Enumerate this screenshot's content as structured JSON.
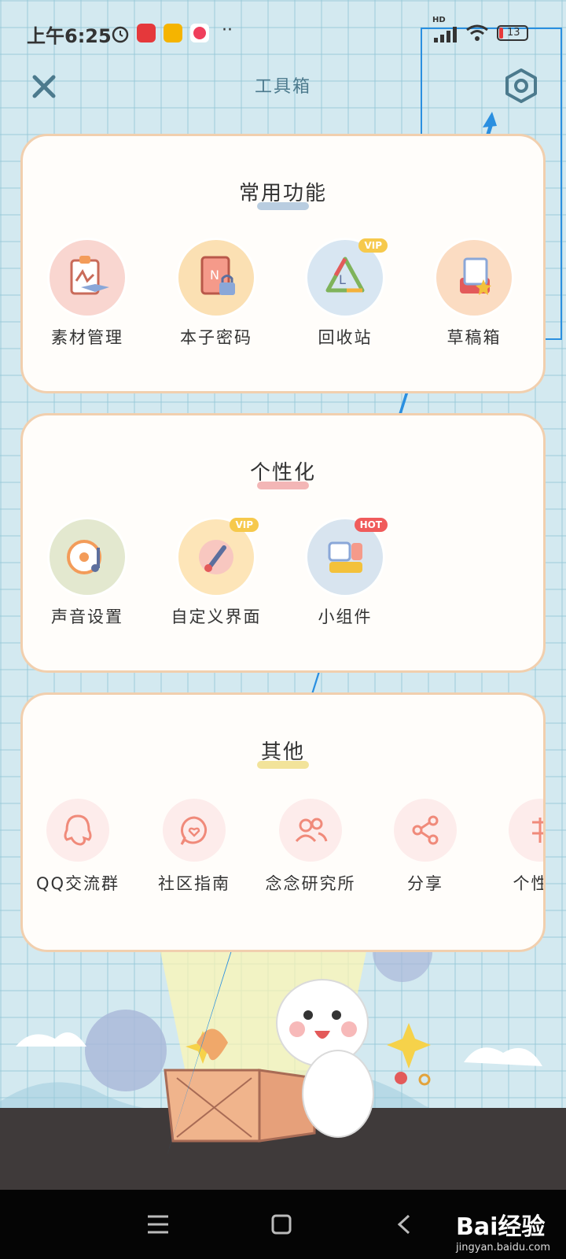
{
  "status_bar": {
    "time": "上午6:25",
    "more": "··",
    "hd": "HD",
    "battery": "13"
  },
  "header": {
    "title": "工具箱"
  },
  "sections": [
    {
      "title": "常用功能",
      "underline_color": "#b9cde0",
      "items": [
        {
          "label": "素材管理",
          "icon": "clipboard-layers-icon",
          "color": "#f9d6d0"
        },
        {
          "label": "本子密码",
          "icon": "notebook-lock-icon",
          "color": "#fbe0b3"
        },
        {
          "label": "回收站",
          "icon": "recycle-icon",
          "color": "#d8e6f2",
          "badge": "VIP"
        },
        {
          "label": "草稿箱",
          "icon": "draft-box-icon",
          "color": "#fbdcc2"
        }
      ]
    },
    {
      "title": "个性化",
      "underline_color": "#f3b6b6",
      "items": [
        {
          "label": "声音设置",
          "icon": "music-disc-icon",
          "color": "#e3e8cf"
        },
        {
          "label": "自定义界面",
          "icon": "paint-brush-icon",
          "color": "#fde5b8",
          "badge": "VIP"
        },
        {
          "label": "小组件",
          "icon": "widget-icon",
          "color": "#d8e4ef",
          "badge": "HOT"
        }
      ]
    },
    {
      "title": "其他",
      "underline_color": "#f2e39a",
      "items": [
        {
          "label": "QQ交流群",
          "icon": "qq-penguin-icon"
        },
        {
          "label": "社区指南",
          "icon": "heart-chat-icon"
        },
        {
          "label": "念念研究所",
          "icon": "people-icon"
        },
        {
          "label": "分享",
          "icon": "share-icon"
        },
        {
          "label": "个性化",
          "icon": "personalize-icon"
        }
      ]
    }
  ],
  "watermark": {
    "brand": "Bai经验",
    "url": "jingyan.baidu.com"
  },
  "colors": {
    "annotation": "#2a8fe0",
    "card_border": "#f1cfae",
    "icon_stroke": "#f08a7a"
  }
}
